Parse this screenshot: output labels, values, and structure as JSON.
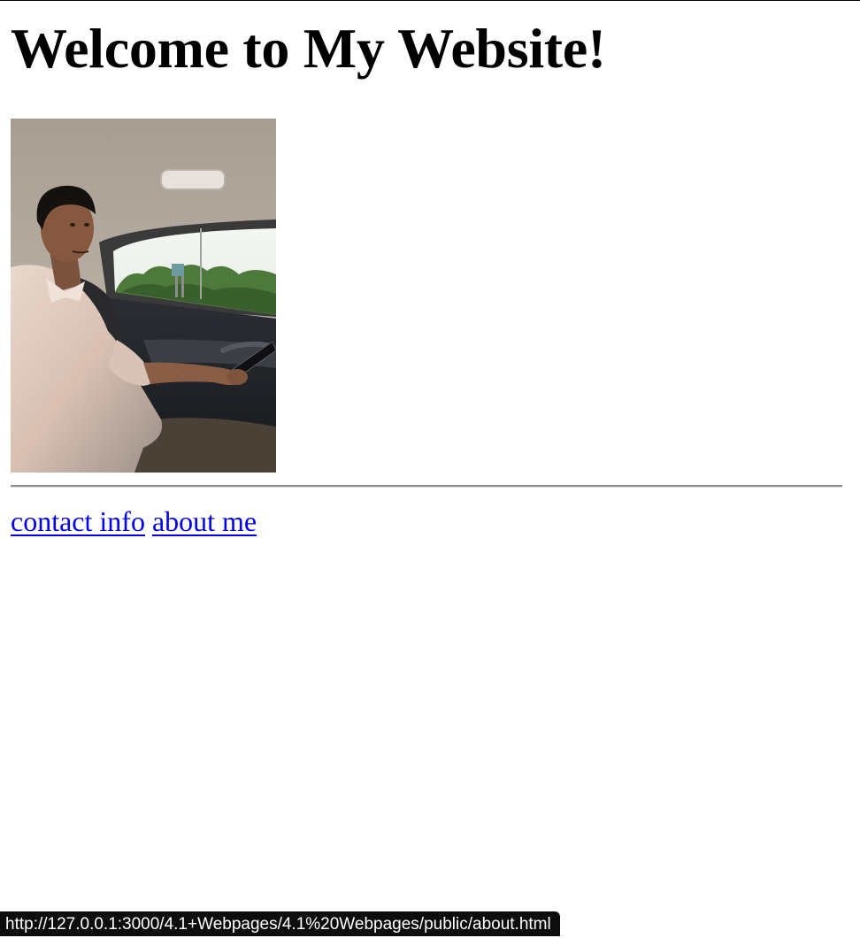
{
  "page": {
    "heading": "Welcome to My Website!",
    "image": {
      "alt": "Young man seated in the back seat of a car, looking at the camera",
      "icon": "profile-photo"
    },
    "nav": {
      "links": [
        {
          "label": "contact info"
        },
        {
          "label": "about me"
        }
      ]
    }
  },
  "status_bar": {
    "url": "http://127.0.0.1:3000/4.1+Webpages/4.1%20Webpages/public/about.html"
  },
  "colors": {
    "link": "#0000ee",
    "text": "#000000",
    "status_bg": "#0d0d0d"
  }
}
